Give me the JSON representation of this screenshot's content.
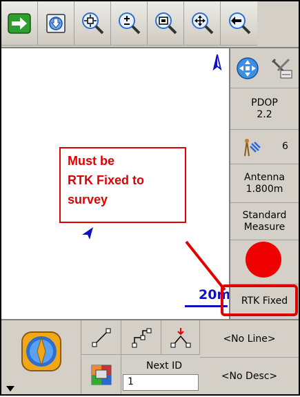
{
  "toolbar": {
    "buttons": [
      {
        "name": "forward-arrow",
        "icon": "right-arrow-icon"
      },
      {
        "name": "download",
        "icon": "download-icon"
      },
      {
        "name": "zoom-extents",
        "icon": "zoom-extents-icon"
      },
      {
        "name": "zoom-in-out",
        "icon": "zoom-plus-minus-icon"
      },
      {
        "name": "zoom-window",
        "icon": "zoom-window-icon"
      },
      {
        "name": "pan",
        "icon": "pan-icon"
      },
      {
        "name": "back",
        "icon": "back-arrow-icon"
      }
    ]
  },
  "map": {
    "scale_label": "20m"
  },
  "callout": {
    "lines": [
      "Must be",
      "RTK Fixed to",
      "survey"
    ]
  },
  "side_panel": {
    "pdop_label": "PDOP",
    "pdop_value": "2.2",
    "satellites": "6",
    "antenna_label": "Antenna",
    "antenna_value": "1.800m",
    "measure_line1": "Standard",
    "measure_line2": "Measure",
    "status": "RTK Fixed"
  },
  "bottom": {
    "line_button": "<No Line>",
    "desc_button": "<No Desc>",
    "next_id_label": "Next ID",
    "next_id_value": "1"
  },
  "colors": {
    "annotation_red": "#e00000",
    "toolbar_bg": "#d4d0c8",
    "scale_blue": "#1010c0"
  }
}
